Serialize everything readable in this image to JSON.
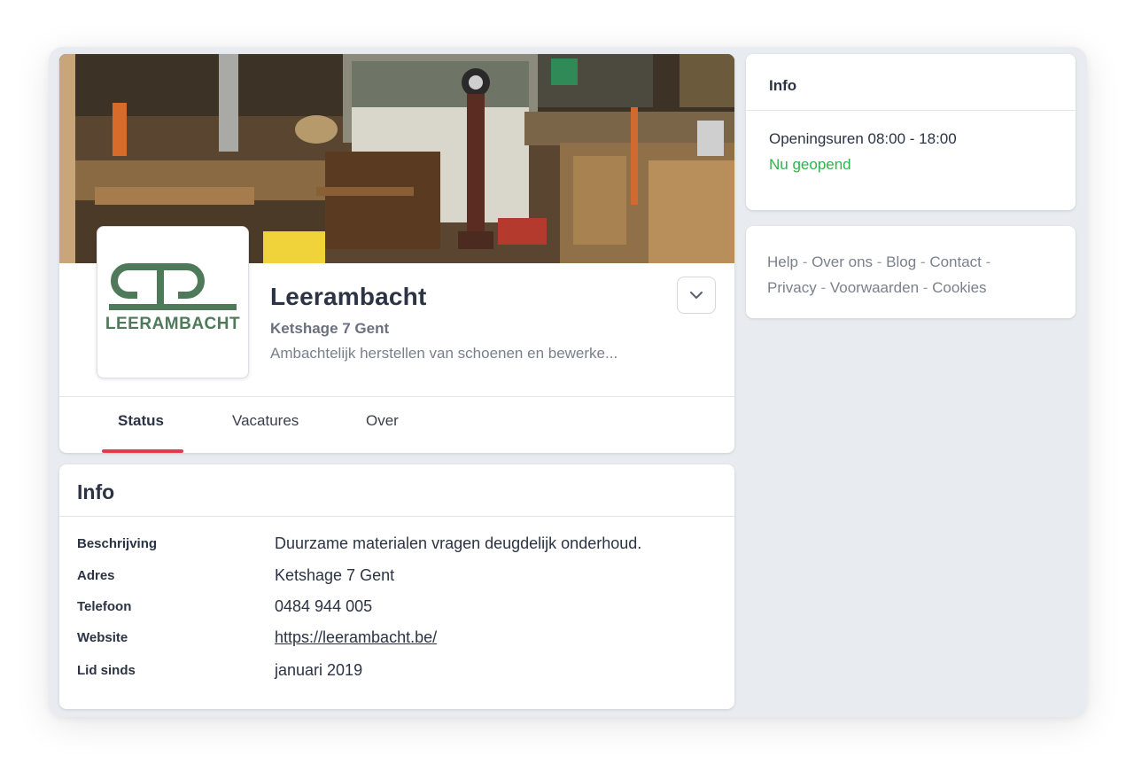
{
  "company": {
    "name": "Leerambacht",
    "address": "Ketshage 7 Gent",
    "description": "Ambachtelijk herstellen van schoenen en bewerke...",
    "logo_text": "LEERAMBACHT"
  },
  "tabs": [
    {
      "label": "Status",
      "active": true
    },
    {
      "label": "Vacatures",
      "active": false
    },
    {
      "label": "Over",
      "active": false
    }
  ],
  "info": {
    "title": "Info",
    "rows": [
      {
        "label": "Beschrijving",
        "value": "Duurzame materialen vragen deugdelijk onderhoud."
      },
      {
        "label": "Adres",
        "value": "Ketshage 7 Gent"
      },
      {
        "label": "Telefoon",
        "value": "0484 944 005"
      },
      {
        "label": "Website",
        "value": "https://leerambacht.be/"
      },
      {
        "label": "Lid sinds",
        "value": "januari 2019"
      }
    ]
  },
  "sidebar": {
    "info_title": "Info",
    "opening_hours": "Openingsuren 08:00 - 18:00",
    "open_status": "Nu geopend",
    "links": [
      "Help",
      "Over ons",
      "Blog",
      "Contact",
      "Privacy",
      "Voorwaarden",
      "Cookies"
    ],
    "separator": " - "
  },
  "colors": {
    "accent": "#e53950",
    "open_green": "#2fb34a",
    "logo_green": "#4e7a5a"
  },
  "icons": {
    "dropdown": "chevron-down-icon"
  }
}
